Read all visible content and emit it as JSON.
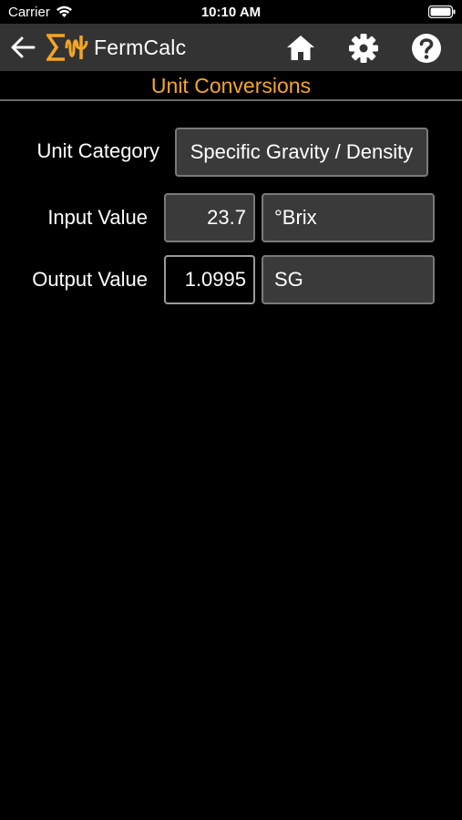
{
  "status_bar": {
    "carrier": "Carrier",
    "time": "10:10 AM"
  },
  "nav": {
    "app_title": "FermCalc",
    "icons": [
      "back-arrow-icon",
      "sigma-logo-icon",
      "home-icon",
      "gear-icon",
      "help-icon"
    ],
    "background": "#333333",
    "logo_color": "#f5a623"
  },
  "page": {
    "title": "Unit Conversions",
    "title_color": "#f5a623"
  },
  "form": {
    "category": {
      "label": "Unit Category",
      "value": "Specific Gravity / Density"
    },
    "input": {
      "label": "Input Value",
      "value": "23.7",
      "unit": "°Brix"
    },
    "output": {
      "label": "Output Value",
      "value": "1.0995",
      "unit": "SG"
    }
  }
}
